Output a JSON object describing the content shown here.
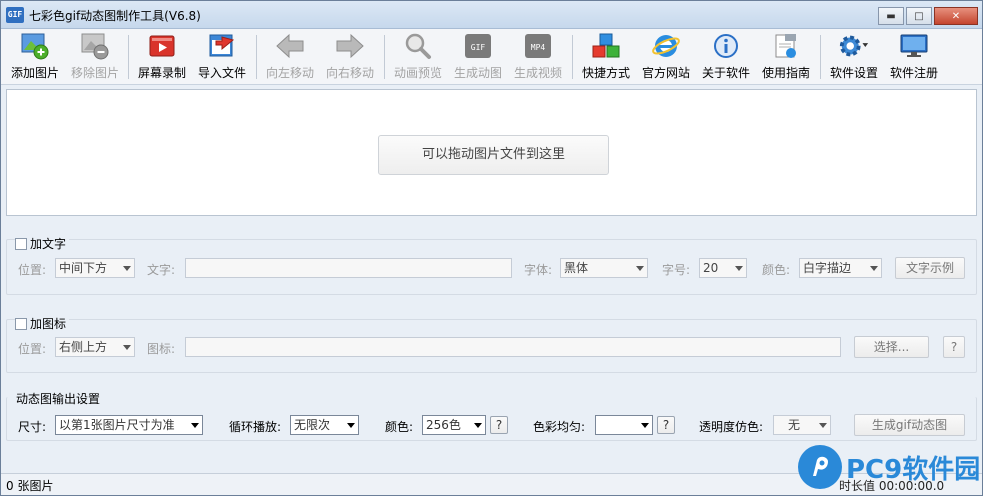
{
  "window": {
    "app_icon_text": "GIF",
    "title": "七彩色gif动态图制作工具(V6.8)",
    "controls": {
      "minimize": "▬",
      "maximize": "□",
      "close": "✕"
    }
  },
  "toolbar": {
    "items": [
      {
        "label": "添加图片",
        "icon": "add-image-icon",
        "enabled": true
      },
      {
        "label": "移除图片",
        "icon": "remove-image-icon",
        "enabled": false
      },
      {
        "label": "屏幕录制",
        "icon": "screen-record-icon",
        "enabled": true
      },
      {
        "label": "导入文件",
        "icon": "import-file-icon",
        "enabled": true
      },
      {
        "label": "向左移动",
        "icon": "arrow-left-icon",
        "enabled": false
      },
      {
        "label": "向右移动",
        "icon": "arrow-right-icon",
        "enabled": false
      },
      {
        "label": "动画预览",
        "icon": "magnifier-icon",
        "enabled": false
      },
      {
        "label": "生成动图",
        "icon": "gif-icon",
        "enabled": false,
        "icon_text": "GIF"
      },
      {
        "label": "生成视频",
        "icon": "mp4-icon",
        "enabled": false,
        "icon_text": "MP4"
      },
      {
        "label": "快捷方式",
        "icon": "shortcut-cubes-icon",
        "enabled": true
      },
      {
        "label": "官方网站",
        "icon": "ie-browser-icon",
        "enabled": true
      },
      {
        "label": "关于软件",
        "icon": "info-icon",
        "enabled": true
      },
      {
        "label": "使用指南",
        "icon": "guide-icon",
        "enabled": true
      },
      {
        "label": "软件设置",
        "icon": "gear-icon",
        "enabled": true
      },
      {
        "label": "软件注册",
        "icon": "monitor-icon",
        "enabled": true
      }
    ]
  },
  "drop_area": {
    "hint": "可以拖动图片文件到这里"
  },
  "add_text": {
    "checkbox_label": "加文字",
    "position_label": "位置:",
    "position_value": "中间下方",
    "text_label": "文字:",
    "font_label": "字体:",
    "font_value": "黑体",
    "size_label": "字号:",
    "size_value": "20",
    "color_label": "颜色:",
    "color_value": "白字描边",
    "sample_button": "文字示例"
  },
  "add_logo": {
    "checkbox_label": "加图标",
    "position_label": "位置:",
    "position_value": "右侧上方",
    "logo_label": "图标:",
    "select_button": "选择...",
    "help_button": "?"
  },
  "output": {
    "title": "动态图输出设置",
    "size_label": "尺寸:",
    "size_value": "以第1张图片尺寸为准",
    "loop_label": "循环播放:",
    "loop_value": "无限次",
    "color_label": "颜色:",
    "color_value": "256色",
    "color_help": "?",
    "balance_label": "色彩均匀:",
    "balance_value": "",
    "balance_help": "?",
    "transparency_label": "透明度仿色:",
    "transparency_value": "无",
    "generate_button": "生成gif动态图"
  },
  "status": {
    "count": "0 张图片",
    "right": "时长值  00:00:00.0"
  },
  "watermark": {
    "text": "PC9软件园"
  }
}
